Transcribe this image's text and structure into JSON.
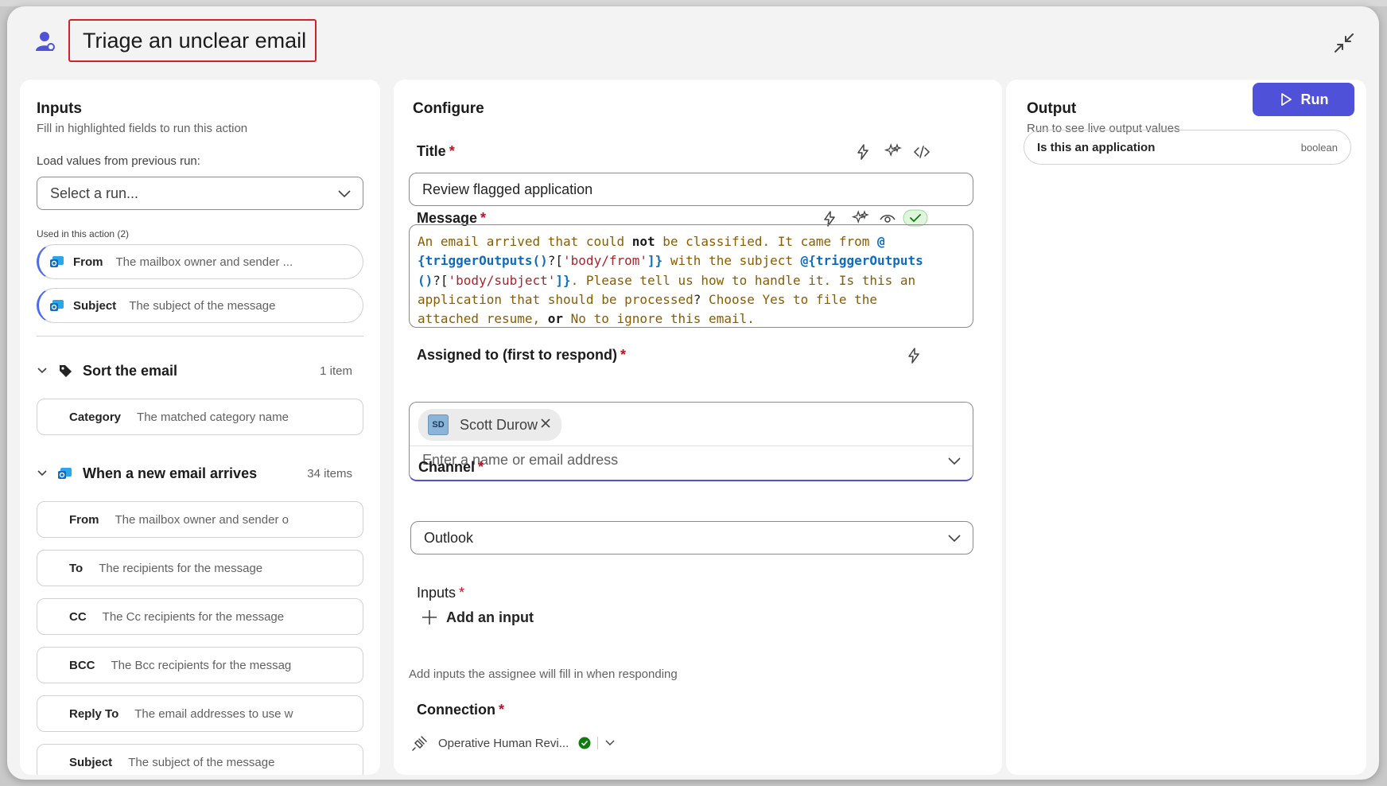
{
  "header": {
    "title": "Triage an unclear email"
  },
  "inputs_panel": {
    "title": "Inputs",
    "subtitle": "Fill in highlighted fields to run this action",
    "load_label": "Load values from previous run:",
    "select_placeholder": "Select a run...",
    "used_label": "Used in this action (2)",
    "used_items": [
      {
        "key": "From",
        "desc": "The mailbox owner and sender ..."
      },
      {
        "key": "Subject",
        "desc": "The subject of the message"
      }
    ],
    "group_sort": {
      "title": "Sort the email",
      "count": "1 item",
      "items": [
        {
          "key": "Category",
          "desc": "The matched category name"
        }
      ]
    },
    "group_email": {
      "title": "When a new email arrives",
      "count": "34 items",
      "items": [
        {
          "key": "From",
          "desc": "The mailbox owner and sender o"
        },
        {
          "key": "To",
          "desc": "The recipients for the message"
        },
        {
          "key": "CC",
          "desc": "The Cc recipients for the message"
        },
        {
          "key": "BCC",
          "desc": "The Bcc recipients for the messag"
        },
        {
          "key": "Reply To",
          "desc": "The email addresses to use w"
        },
        {
          "key": "Subject",
          "desc": "The subject of the message"
        }
      ]
    }
  },
  "configure_panel": {
    "title": "Configure",
    "title_field": {
      "label": "Title",
      "value": "Review flagged application"
    },
    "message_field": {
      "label": "Message",
      "parts": [
        {
          "t": "An email arrived that could ",
          "c": "text"
        },
        {
          "t": "not",
          "c": "kw"
        },
        {
          "t": " be classified. It came from ",
          "c": "text"
        },
        {
          "t": "@\n{triggerOutputs()",
          "c": "fn"
        },
        {
          "t": "?[",
          "c": "plain"
        },
        {
          "t": "'body/from'",
          "c": "str"
        },
        {
          "t": "]}",
          "c": "fn"
        },
        {
          "t": " with the subject ",
          "c": "text"
        },
        {
          "t": "@{triggerOutputs\n()",
          "c": "fn"
        },
        {
          "t": "?[",
          "c": "plain"
        },
        {
          "t": "'body/subject'",
          "c": "str"
        },
        {
          "t": "]}",
          "c": "fn"
        },
        {
          "t": ". Please tell us how to handle it. Is this an\napplication that should be processed",
          "c": "text"
        },
        {
          "t": "?",
          "c": "plain"
        },
        {
          "t": " Choose Yes to file the\nattached resume, ",
          "c": "text"
        },
        {
          "t": "or",
          "c": "kw"
        },
        {
          "t": " No to ignore this email.",
          "c": "text"
        }
      ]
    },
    "assigned_field": {
      "label": "Assigned to (first to respond)",
      "chip_initials": "SD",
      "chip_name": "Scott Durow",
      "placeholder": "Enter a name or email address"
    },
    "channel_field": {
      "label": "Channel",
      "value": "Outlook"
    },
    "inputs_field": {
      "label": "Inputs",
      "add_label": "Add an input",
      "hint": "Add inputs the assignee will fill in when responding"
    },
    "connection_field": {
      "label": "Connection",
      "value": "Operative Human Revi..."
    }
  },
  "output_panel": {
    "title": "Output",
    "subtitle": "Run to see live output values",
    "run_label": "Run",
    "item": {
      "name": "Is this an application",
      "type": "boolean"
    }
  },
  "colors": {
    "accent": "#4f52d8",
    "required": "#c50f1f",
    "title_highlight": "#d4202a",
    "success": "#107c10"
  }
}
